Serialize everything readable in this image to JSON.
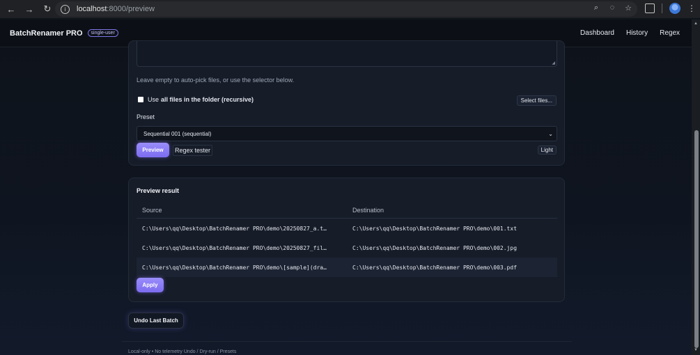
{
  "browser": {
    "url_host": "localhost",
    "url_path": ":8000/preview"
  },
  "header": {
    "brand": "BatchRenamer PRO",
    "badge": "single-user",
    "nav": [
      "Dashboard",
      "History",
      "Regex"
    ]
  },
  "form": {
    "hint": "Leave empty to auto-pick files, or use the selector below.",
    "checkbox_prefix": "Use",
    "checkbox_bold": "all files in the folder (recursive)",
    "select_files_label": "Select files...",
    "preset_label": "Preset",
    "preset_value": "Sequential 001 (sequential)",
    "preview_label": "Preview",
    "regex_tester_label": "Regex tester",
    "light_label": "Light"
  },
  "preview": {
    "title": "Preview result",
    "columns": [
      "Source",
      "Destination"
    ],
    "rows": [
      {
        "source": "C:\\Users\\qq\\Desktop\\BatchRenamer PRO\\demo\\20250827_a.t…",
        "destination": "C:\\Users\\qq\\Desktop\\BatchRenamer PRO\\demo\\001.txt"
      },
      {
        "source": "C:\\Users\\qq\\Desktop\\BatchRenamer PRO\\demo\\20250827_fil…",
        "destination": "C:\\Users\\qq\\Desktop\\BatchRenamer PRO\\demo\\002.jpg"
      },
      {
        "source": "C:\\Users\\qq\\Desktop\\BatchRenamer PRO\\demo\\[sample](dra…",
        "destination": "C:\\Users\\qq\\Desktop\\BatchRenamer PRO\\demo\\003.pdf"
      }
    ],
    "apply_label": "Apply"
  },
  "undo_label": "Undo Last Batch",
  "footer": "Local-only • No telemetry   Undo / Dry-run / Presets",
  "colors": {
    "accent": "#8b7cf6",
    "background": "#0f141c",
    "card": "#161c28"
  }
}
